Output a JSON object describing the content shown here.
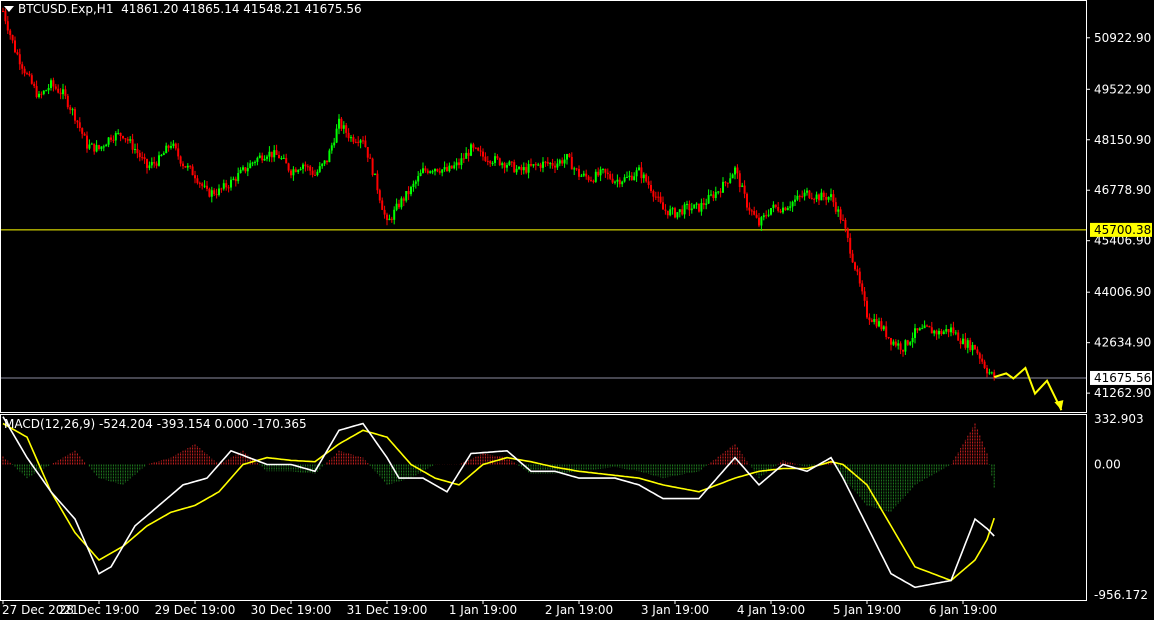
{
  "header": {
    "symbol": "BTCUSD.Exp,H1",
    "open": "41861.20",
    "high": "41865.14",
    "low": "41548.21",
    "close": "41675.56"
  },
  "macd": {
    "label": "MACD(12,26,9)",
    "values": "-524.204 -393.154 0.000 -170.365"
  },
  "colors": {
    "background": "#000000",
    "bull": "#00ff00",
    "bear": "#ff0000",
    "macd_line": "#ffffff",
    "signal_line": "#ffff00",
    "hline": "#ffff00",
    "bid_line": "#8c8ca0",
    "axis_text": "#ffffff"
  },
  "chart_data": [
    {
      "type": "candlestick",
      "timeframe": "H1",
      "price_axis_ticks": [
        "50922.90",
        "49522.90",
        "48150.90",
        "46778.90",
        "45406.90",
        "44006.90",
        "42634.90",
        "41262.90"
      ],
      "x_ticks": [
        "27 Dec 2021",
        "28 Dec 19:00",
        "29 Dec 19:00",
        "30 Dec 19:00",
        "31 Dec 19:00",
        "1 Jan 19:00",
        "2 Jan 19:00",
        "3 Jan 19:00",
        "4 Jan 19:00",
        "5 Jan 19:00",
        "6 Jan 19:00"
      ],
      "ylim": [
        40750,
        51950
      ],
      "horizontal_line": {
        "value": 45700.38,
        "label": "45700.38"
      },
      "current_price": {
        "value": 41675.56,
        "label": "41675.56"
      },
      "close_path": [
        [
          0,
          51650
        ],
        [
          5,
          50600
        ],
        [
          10,
          49900
        ],
        [
          15,
          49300
        ],
        [
          20,
          49650
        ],
        [
          25,
          49400
        ],
        [
          30,
          48800
        ],
        [
          35,
          48000
        ],
        [
          40,
          47900
        ],
        [
          45,
          48250
        ],
        [
          50,
          48300
        ],
        [
          55,
          47900
        ],
        [
          60,
          47400
        ],
        [
          65,
          47600
        ],
        [
          70,
          48050
        ],
        [
          75,
          47500
        ],
        [
          80,
          47200
        ],
        [
          85,
          46700
        ],
        [
          90,
          46750
        ],
        [
          95,
          47000
        ],
        [
          100,
          47300
        ],
        [
          105,
          47600
        ],
        [
          110,
          47800
        ],
        [
          115,
          47700
        ],
        [
          120,
          47300
        ],
        [
          125,
          47500
        ],
        [
          130,
          47200
        ],
        [
          135,
          47600
        ],
        [
          140,
          48600
        ],
        [
          145,
          48200
        ],
        [
          150,
          48200
        ],
        [
          155,
          47100
        ],
        [
          160,
          45850
        ],
        [
          165,
          46400
        ],
        [
          170,
          46800
        ],
        [
          175,
          47300
        ],
        [
          180,
          47400
        ],
        [
          185,
          47300
        ],
        [
          190,
          47500
        ],
        [
          195,
          47900
        ],
        [
          200,
          47700
        ],
        [
          205,
          47600
        ],
        [
          210,
          47500
        ],
        [
          215,
          47300
        ],
        [
          220,
          47400
        ],
        [
          225,
          47500
        ],
        [
          230,
          47500
        ],
        [
          235,
          47650
        ],
        [
          240,
          47200
        ],
        [
          245,
          47100
        ],
        [
          250,
          47250
        ],
        [
          255,
          47050
        ],
        [
          260,
          47100
        ],
        [
          265,
          47300
        ],
        [
          270,
          46850
        ],
        [
          275,
          46250
        ],
        [
          280,
          46150
        ],
        [
          285,
          46300
        ],
        [
          290,
          46300
        ],
        [
          295,
          46600
        ],
        [
          300,
          46900
        ],
        [
          305,
          47350
        ],
        [
          310,
          46400
        ],
        [
          315,
          45850
        ],
        [
          320,
          46300
        ],
        [
          325,
          46300
        ],
        [
          330,
          46500
        ],
        [
          335,
          46700
        ],
        [
          340,
          46600
        ],
        [
          345,
          46600
        ],
        [
          350,
          45900
        ],
        [
          355,
          44700
        ],
        [
          360,
          43400
        ],
        [
          365,
          43150
        ],
        [
          370,
          42700
        ],
        [
          375,
          42500
        ],
        [
          380,
          42900
        ],
        [
          385,
          43000
        ],
        [
          390,
          42900
        ],
        [
          395,
          43000
        ],
        [
          400,
          42650
        ],
        [
          405,
          42500
        ],
        [
          410,
          41900
        ],
        [
          413,
          41675.56
        ]
      ],
      "projection_path": [
        [
          413,
          41700
        ],
        [
          418,
          41800
        ],
        [
          421,
          41660
        ],
        [
          426,
          41950
        ],
        [
          430,
          41250
        ],
        [
          435,
          41600
        ],
        [
          441,
          40800
        ]
      ]
    },
    {
      "type": "macd",
      "params": "12,26,9",
      "yaxis_ticks": [
        "332.903",
        "0.00",
        "-956.172"
      ],
      "ylim": [
        -956.172,
        332.903
      ],
      "macd_line": [
        [
          0,
          350
        ],
        [
          10,
          50
        ],
        [
          20,
          -200
        ],
        [
          30,
          -400
        ],
        [
          40,
          -800
        ],
        [
          45,
          -750
        ],
        [
          55,
          -450
        ],
        [
          65,
          -300
        ],
        [
          75,
          -150
        ],
        [
          85,
          -100
        ],
        [
          95,
          100
        ],
        [
          110,
          0
        ],
        [
          120,
          0
        ],
        [
          130,
          -50
        ],
        [
          140,
          250
        ],
        [
          150,
          300
        ],
        [
          160,
          50
        ],
        [
          165,
          -100
        ],
        [
          175,
          -100
        ],
        [
          185,
          -200
        ],
        [
          195,
          80
        ],
        [
          210,
          100
        ],
        [
          220,
          -50
        ],
        [
          230,
          -50
        ],
        [
          240,
          -100
        ],
        [
          255,
          -100
        ],
        [
          265,
          -150
        ],
        [
          275,
          -250
        ],
        [
          290,
          -250
        ],
        [
          305,
          50
        ],
        [
          315,
          -150
        ],
        [
          325,
          0
        ],
        [
          335,
          -50
        ],
        [
          345,
          50
        ],
        [
          350,
          -100
        ],
        [
          360,
          -450
        ],
        [
          370,
          -800
        ],
        [
          380,
          -900
        ],
        [
          395,
          -850
        ],
        [
          405,
          -400
        ],
        [
          410,
          -470
        ],
        [
          413,
          -524.204
        ]
      ],
      "signal_line": [
        [
          0,
          300
        ],
        [
          10,
          200
        ],
        [
          20,
          -200
        ],
        [
          30,
          -500
        ],
        [
          40,
          -700
        ],
        [
          50,
          -600
        ],
        [
          60,
          -450
        ],
        [
          70,
          -350
        ],
        [
          80,
          -300
        ],
        [
          90,
          -200
        ],
        [
          100,
          0
        ],
        [
          110,
          50
        ],
        [
          120,
          30
        ],
        [
          130,
          20
        ],
        [
          140,
          150
        ],
        [
          150,
          250
        ],
        [
          160,
          200
        ],
        [
          170,
          0
        ],
        [
          180,
          -100
        ],
        [
          190,
          -150
        ],
        [
          200,
          0
        ],
        [
          210,
          50
        ],
        [
          220,
          20
        ],
        [
          230,
          -20
        ],
        [
          240,
          -50
        ],
        [
          255,
          -80
        ],
        [
          265,
          -100
        ],
        [
          275,
          -150
        ],
        [
          290,
          -200
        ],
        [
          305,
          -100
        ],
        [
          315,
          -50
        ],
        [
          325,
          -30
        ],
        [
          335,
          -30
        ],
        [
          345,
          20
        ],
        [
          350,
          0
        ],
        [
          360,
          -150
        ],
        [
          370,
          -450
        ],
        [
          380,
          -750
        ],
        [
          395,
          -850
        ],
        [
          405,
          -700
        ],
        [
          410,
          -550
        ],
        [
          413,
          -393.154
        ]
      ],
      "histogram": [
        [
          0,
          60
        ],
        [
          10,
          -100
        ],
        [
          20,
          0
        ],
        [
          30,
          100
        ],
        [
          40,
          -100
        ],
        [
          50,
          -150
        ],
        [
          60,
          0
        ],
        [
          70,
          50
        ],
        [
          80,
          150
        ],
        [
          90,
          0
        ],
        [
          100,
          100
        ],
        [
          110,
          -50
        ],
        [
          120,
          -50
        ],
        [
          130,
          -70
        ],
        [
          140,
          100
        ],
        [
          150,
          50
        ],
        [
          160,
          -150
        ],
        [
          170,
          -100
        ],
        [
          180,
          0
        ],
        [
          190,
          0
        ],
        [
          200,
          80
        ],
        [
          210,
          50
        ],
        [
          220,
          -70
        ],
        [
          230,
          -70
        ],
        [
          240,
          -50
        ],
        [
          255,
          -20
        ],
        [
          265,
          -50
        ],
        [
          275,
          -100
        ],
        [
          290,
          -50
        ],
        [
          305,
          150
        ],
        [
          315,
          -100
        ],
        [
          325,
          30
        ],
        [
          335,
          -20
        ],
        [
          345,
          30
        ],
        [
          350,
          -100
        ],
        [
          360,
          -300
        ],
        [
          370,
          -350
        ],
        [
          380,
          -150
        ],
        [
          395,
          0
        ],
        [
          405,
          300
        ],
        [
          410,
          80
        ],
        [
          413,
          -170.365
        ]
      ]
    }
  ]
}
